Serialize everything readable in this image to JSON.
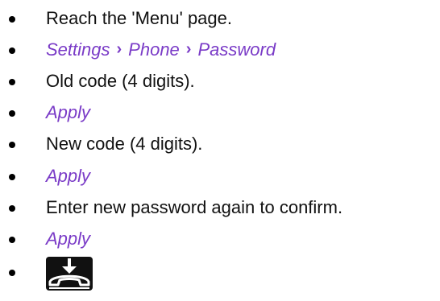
{
  "steps": [
    {
      "type": "text",
      "text": "Reach the 'Menu' page."
    },
    {
      "type": "path",
      "items": [
        "Settings",
        "Phone",
        "Password"
      ],
      "separator": "›"
    },
    {
      "type": "text",
      "text": "Old code (4 digits)."
    },
    {
      "type": "action",
      "text": "Apply"
    },
    {
      "type": "text",
      "text": "New code (4 digits)."
    },
    {
      "type": "action",
      "text": "Apply"
    },
    {
      "type": "text",
      "text": "Enter new password again to confirm."
    },
    {
      "type": "action",
      "text": "Apply"
    },
    {
      "type": "key",
      "icon": "hang-up-key-icon"
    }
  ],
  "colors": {
    "text": "#111111",
    "menu_link": "#7a3bc7",
    "key_background": "#111111"
  }
}
